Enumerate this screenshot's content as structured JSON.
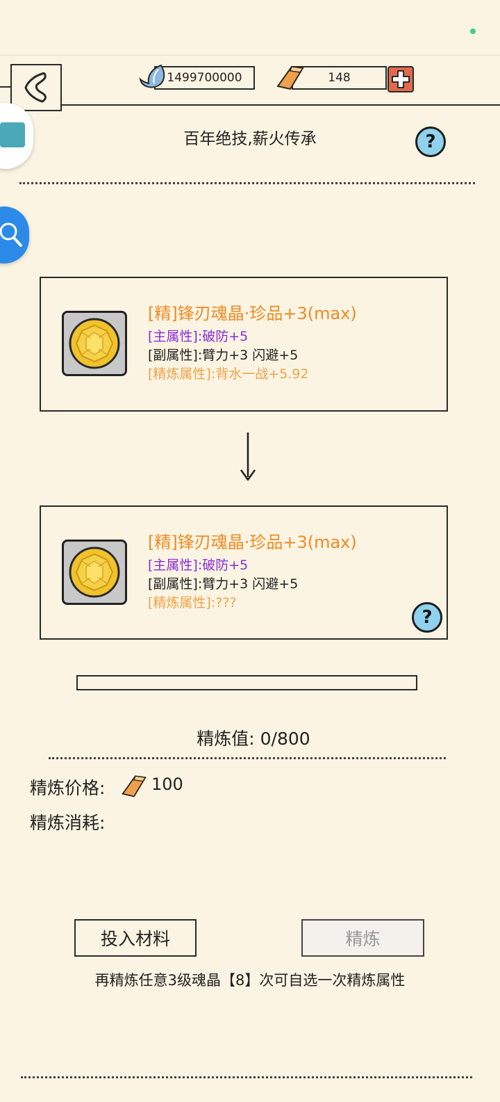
{
  "header": {
    "soul_amount": "1499700000",
    "gold_amount": "148",
    "title": "百年绝技,薪火传承"
  },
  "items": [
    {
      "title": "[精]锋刃魂晶·珍品+3(max)",
      "main_label": "[主属性]",
      "main_value": ":破防+5",
      "sub_label": "[副属性]",
      "sub_value": ":臂力+3 闪避+5",
      "refine_label": "[精炼属性]",
      "refine_value": ":背水一战+5.92"
    },
    {
      "title": "[精]锋刃魂晶·珍品+3(max)",
      "main_label": "[主属性]",
      "main_value": ":破防+5",
      "sub_label": "[副属性]",
      "sub_value": ":臂力+3 闪避+5",
      "refine_label": "[精炼属性]",
      "refine_value": ":???"
    }
  ],
  "refine": {
    "value_label": "精炼值: ",
    "value": "0/800",
    "progress": 0,
    "price_label": "精炼价格:",
    "price_value": "100",
    "cost_label": "精炼消耗:"
  },
  "buttons": {
    "add_material": "投入材料",
    "refine": "精炼"
  },
  "hint": "再精炼任意3级魂晶【8】次可自选一次精炼属性",
  "colors": {
    "title_orange": "#f08a24",
    "main_attr_purple": "#8a2bd8",
    "refine_attr_orange": "#f0a24a",
    "help_blue": "#8fd2ee"
  }
}
